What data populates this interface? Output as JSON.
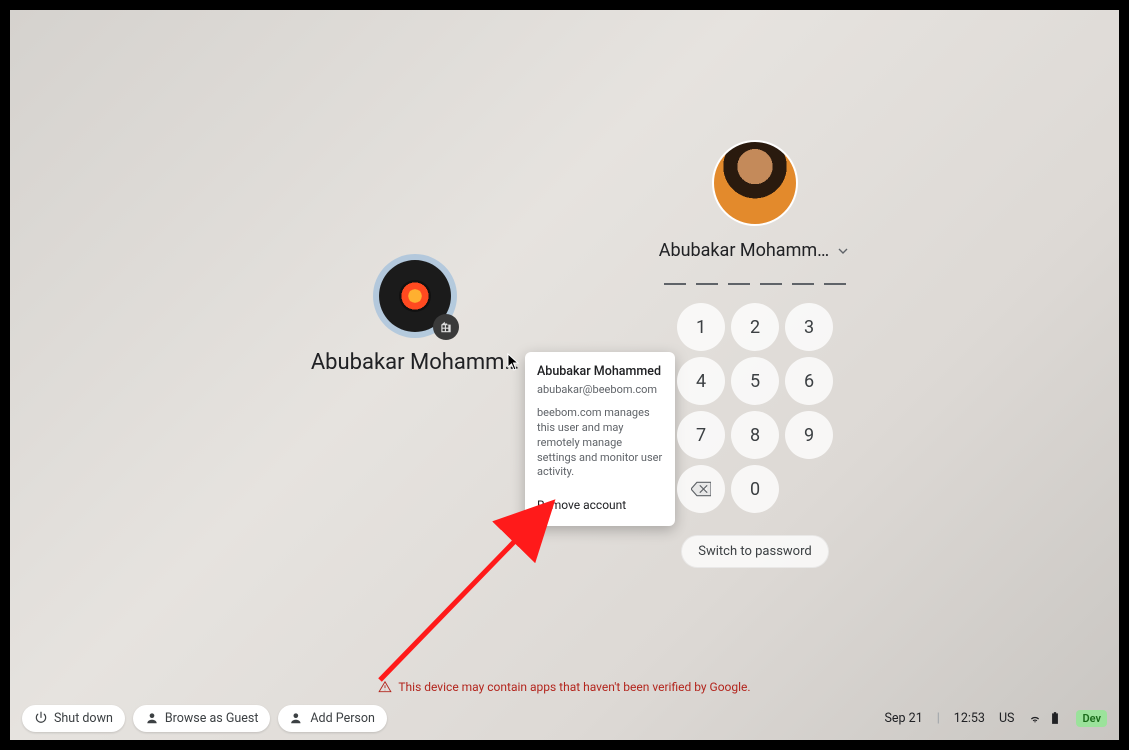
{
  "secondary_user": {
    "display_name": "Abubakar Mohamm…",
    "icon": "enterprise-icon"
  },
  "primary_user": {
    "display_name": "Abubakar Mohamm…",
    "chevron_icon": "chevron-down-icon"
  },
  "keypad": {
    "keys": [
      "1",
      "2",
      "3",
      "4",
      "5",
      "6",
      "7",
      "8",
      "9",
      "",
      "0",
      ""
    ],
    "backspace_icon": "backspace-icon"
  },
  "switch_button": {
    "label": "Switch to password"
  },
  "account_card": {
    "name": "Abubakar Mohammed",
    "email": "abubakar@beebom.com",
    "info": "beebom.com manages this user and may remotely manage settings and monitor user activity.",
    "remove_label": "Remove account"
  },
  "warning": {
    "text": "This device may contain apps that haven't been verified by Google."
  },
  "footer": {
    "shutdown_label": "Shut down",
    "guest_label": "Browse as Guest",
    "add_person_label": "Add Person",
    "date": "Sep 21",
    "time": "12:53",
    "locale": "US",
    "dev_label": "Dev"
  }
}
